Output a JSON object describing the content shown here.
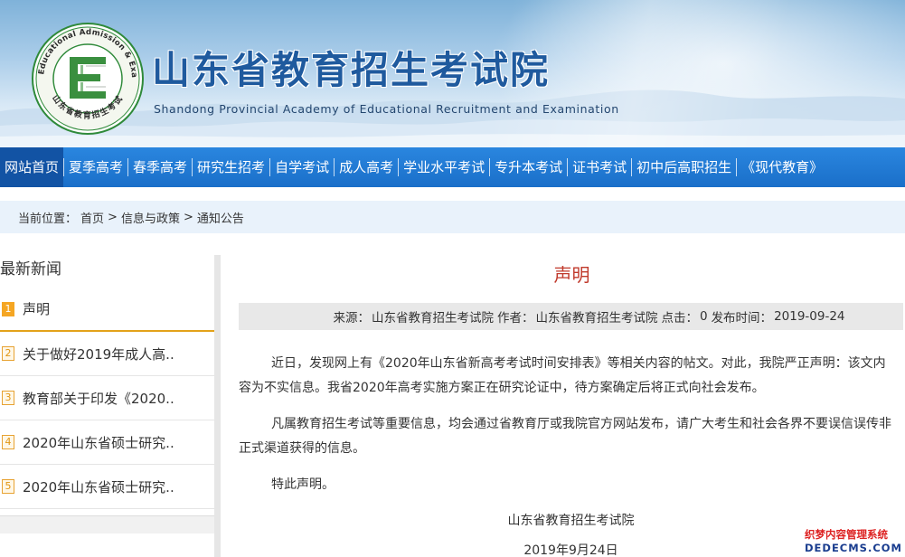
{
  "header": {
    "title": "山东省教育招生考试院",
    "subtitle": "Shandong Provincial Academy of Educational Recruitment and Examination",
    "logo": {
      "ring_text": "Shandong Educational Admission & Examinations",
      "inner_text": "山东省教育招生考试",
      "colors": {
        "outer_ring": "#2f8a3a",
        "letter": "#3a8f3f",
        "ring_bg": "#f4f7ef"
      }
    }
  },
  "nav": {
    "items": [
      {
        "label": "网站首页",
        "active": true
      },
      {
        "label": "夏季高考"
      },
      {
        "label": "春季高考"
      },
      {
        "label": "研究生招考"
      },
      {
        "label": "自学考试"
      },
      {
        "label": "成人高考"
      },
      {
        "label": "学业水平考试"
      },
      {
        "label": "专升本考试"
      },
      {
        "label": "证书考试"
      },
      {
        "label": "初中后高职招生"
      },
      {
        "label": "《现代教育》"
      }
    ]
  },
  "breadcrumb": {
    "prefix": "当前位置：",
    "items": [
      "首页",
      "信息与政策",
      "通知公告"
    ],
    "separator": ">"
  },
  "sidebar": {
    "title": "最新新闻",
    "items": [
      {
        "num": "1",
        "text": "声明",
        "active": true
      },
      {
        "num": "2",
        "text": "关于做好2019年成人高.."
      },
      {
        "num": "3",
        "text": "教育部关于印发《2020.."
      },
      {
        "num": "4",
        "text": "2020年山东省硕士研究.."
      },
      {
        "num": "5",
        "text": "2020年山东省硕士研究.."
      }
    ]
  },
  "article": {
    "title": "声明",
    "meta": {
      "source_label": "来源：",
      "source": "山东省教育招生考试院",
      "author_label": "作者：",
      "author": "山东省教育招生考试院",
      "clicks_label": "点击：",
      "clicks": "0",
      "date_label": "发布时间：",
      "date": "2019-09-24"
    },
    "paragraphs": [
      "近日，发现网上有《2020年山东省新高考考试时间安排表》等相关内容的帖文。对此，我院严正声明：该文内容为不实信息。我省2020年高考实施方案正在研究论证中，待方案确定后将正式向社会发布。",
      "凡属教育招生考试等重要信息，均会通过省教育厅或我院官方网站发布，请广大考生和社会各界不要误信误传非正式渠道获得的信息。",
      "特此声明。"
    ],
    "signature": "山东省教育招生考试院",
    "sign_date": "2019年9月24日"
  },
  "watermark": {
    "line1": "织梦内容管理系统",
    "line2": "DEDECMS.COM"
  }
}
